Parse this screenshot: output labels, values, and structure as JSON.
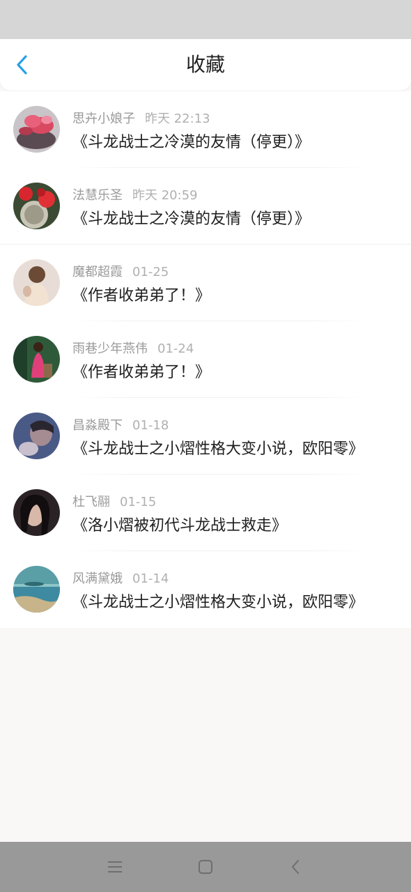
{
  "header": {
    "title": "收藏",
    "back_icon": "chevron-left-icon",
    "accent_color": "#2aa0e8"
  },
  "items": [
    {
      "user": "思卉小娘子",
      "time": "昨天 22:13",
      "title": "《斗龙战士之冷漠的友情（停更）》",
      "avatar": "red-flowers-photo"
    },
    {
      "user": "法慧乐圣",
      "time": "昨天 20:59",
      "title": "《斗龙战士之冷漠的友情（停更）》",
      "avatar": "cactus-flowers-photo"
    },
    {
      "user": "魔都超霞",
      "time": "01-25",
      "title": "《作者收弟弟了！》",
      "avatar": "girl-back-photo"
    },
    {
      "user": "雨巷少年燕伟",
      "time": "01-24",
      "title": "《作者收弟弟了！》",
      "avatar": "girl-pink-dress-photo"
    },
    {
      "user": "昌淼殿下",
      "time": "01-18",
      "title": "《斗龙战士之小熠性格大变小说，欧阳零》",
      "avatar": "blue-portrait-photo"
    },
    {
      "user": "杜飞翮",
      "time": "01-15",
      "title": "《洛小熠被初代斗龙战士救走》",
      "avatar": "dark-portrait-photo"
    },
    {
      "user": "风满黛娥",
      "time": "01-14",
      "title": "《斗龙战士之小熠性格大变小说，欧阳零》",
      "avatar": "sea-landscape-photo"
    }
  ],
  "nav": {
    "menu_icon": "menu-icon",
    "home_icon": "home-square-icon",
    "back_icon": "back-triangle-icon"
  }
}
